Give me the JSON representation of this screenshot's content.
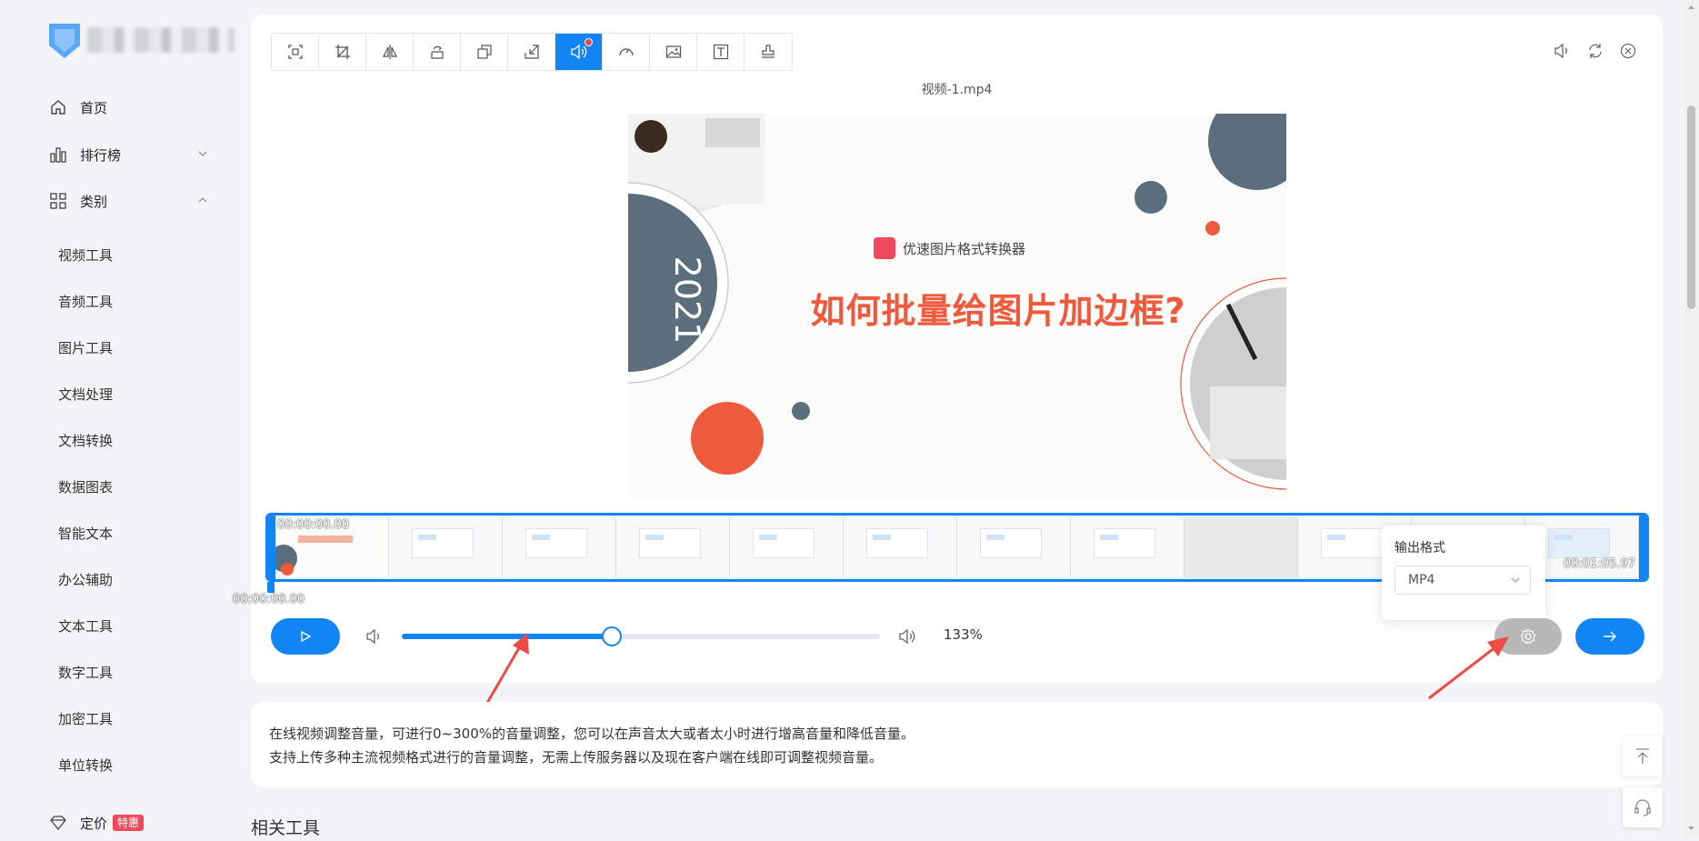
{
  "sidebar": {
    "home": "首页",
    "ranking": "排行榜",
    "category": "类别",
    "items": [
      "视频工具",
      "音频工具",
      "图片工具",
      "文档处理",
      "文档转换",
      "数据图表",
      "智能文本",
      "办公辅助",
      "文本工具",
      "数字工具",
      "加密工具",
      "单位转换"
    ],
    "pricing": "定价",
    "pricing_badge": "特惠"
  },
  "editor": {
    "toolbar_icons": [
      "crop-frame-icon",
      "crop-icon",
      "flip-icon",
      "rotate-icon",
      "resize-icon",
      "scale-icon",
      "volume-icon",
      "speed-icon",
      "image-icon",
      "text-icon",
      "stamp-icon"
    ],
    "active_tool": "volume-icon",
    "filename": "视频-1.mp4",
    "preview": {
      "watermark": "优速图片格式转换器",
      "headline": "如何批量给图片加边框?",
      "year": "2021"
    },
    "timeline": {
      "start_time": "00:00:00.00",
      "end_time": "00:01:05.97",
      "current_time": "00:00:00.00"
    },
    "output": {
      "label": "输出格式",
      "format": "MP4"
    },
    "volume": {
      "percent_label": "133%",
      "fraction": 0.44
    }
  },
  "description": {
    "line1": "在线视频调整音量，可进行0~300%的音量调整，您可以在声音太大或者太小时进行增高音量和降低音量。",
    "line2": "支持上传多种主流视频格式进行的音量调整，无需上传服务器以及现在客户端在线即可调整视频音量。"
  },
  "related_title": "相关工具",
  "colors": {
    "accent": "#1185f3",
    "headline": "#ef5a3c",
    "badge": "#ef4a5a",
    "annotation_arrow": "#f04a45"
  }
}
